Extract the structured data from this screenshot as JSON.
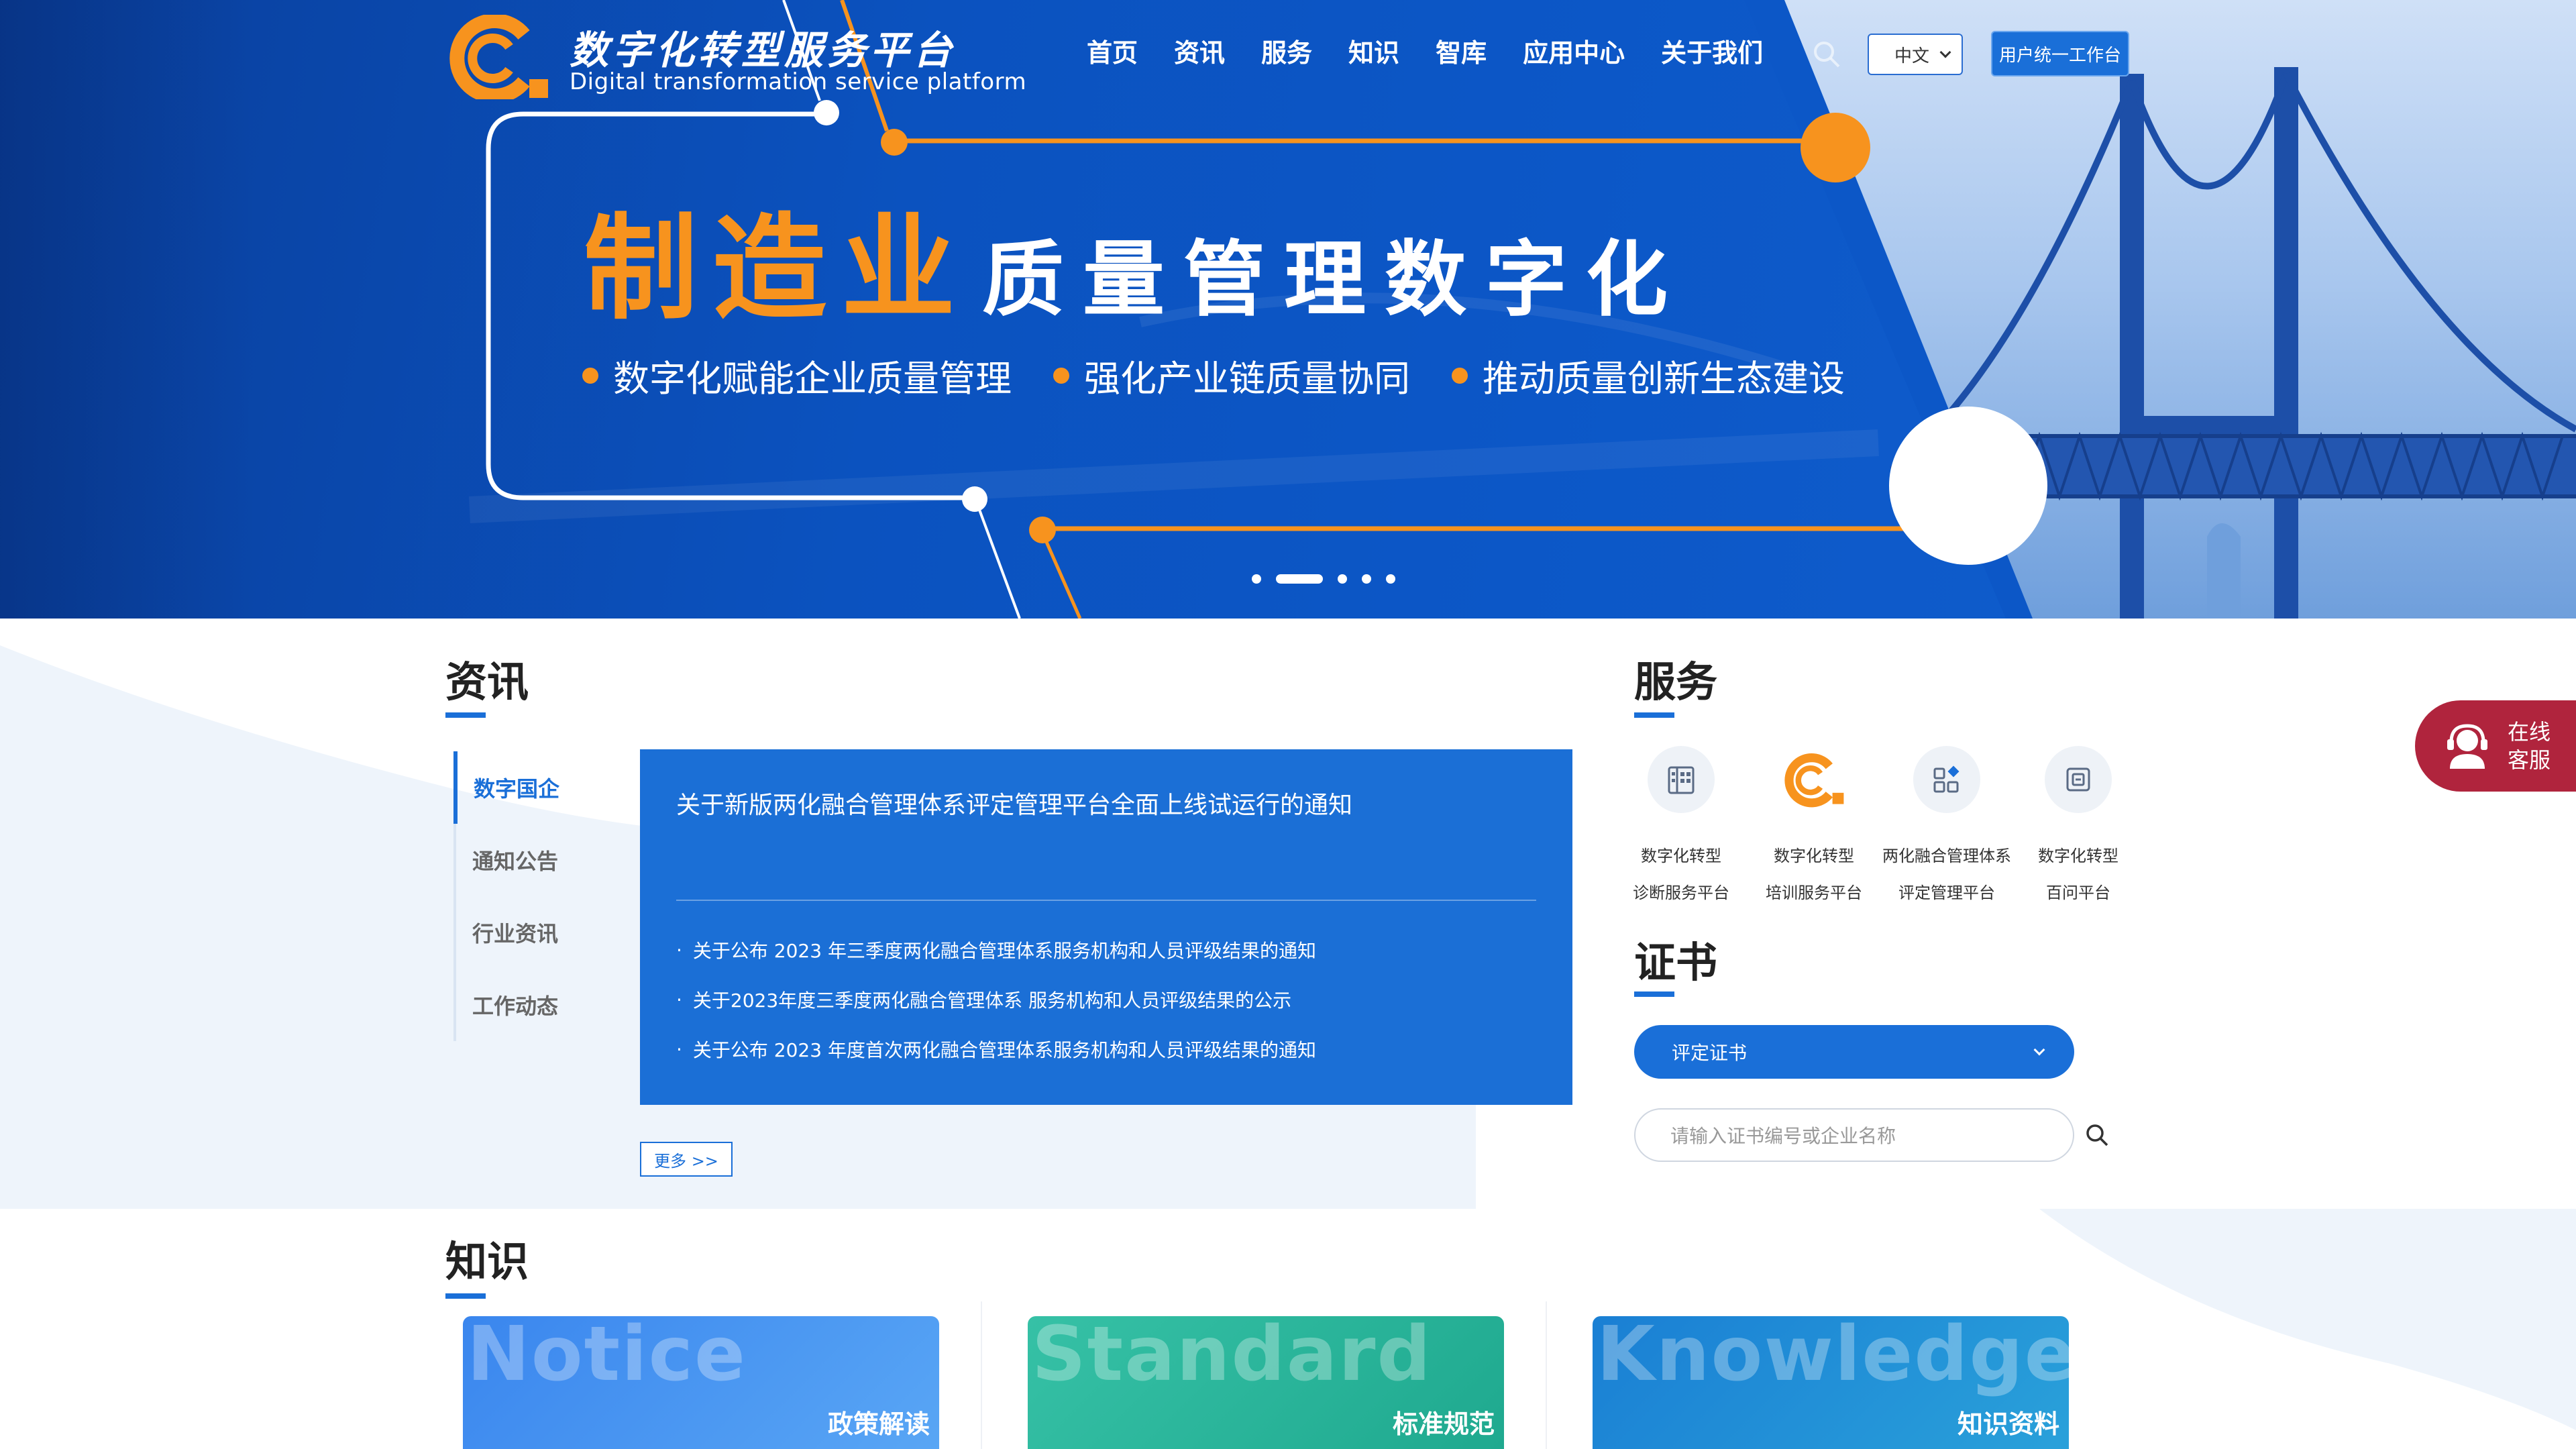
{
  "brand": {
    "name_cn": "数字化转型服务平台",
    "name_en": "Digital transformation service platform",
    "orange": "#f7931e",
    "blue": "#1a6fd8"
  },
  "nav": {
    "items": [
      {
        "label": "首页"
      },
      {
        "label": "资讯"
      },
      {
        "label": "服务"
      },
      {
        "label": "知识"
      },
      {
        "label": "智库"
      },
      {
        "label": "应用中心"
      },
      {
        "label": "关于我们"
      }
    ],
    "search_icon": "search-icon",
    "language": "中文",
    "workbench_label": "用户统一工作台"
  },
  "banner": {
    "title_highlight": "制造业",
    "title_rest": "质量管理数字化",
    "bullets": [
      {
        "text": "数字化赋能企业质量管理"
      },
      {
        "text": "强化产业链质量协同"
      },
      {
        "text": "推动质量创新生态建设"
      }
    ],
    "slide_count": 5,
    "active_slide": 2
  },
  "news": {
    "title": "资讯",
    "tabs": [
      {
        "label": "数字国企",
        "active": true
      },
      {
        "label": "通知公告",
        "active": false
      },
      {
        "label": "行业资讯",
        "active": false
      },
      {
        "label": "工作动态",
        "active": false
      }
    ],
    "headline": "关于新版两化融合管理体系评定管理平台全面上线试运行的通知",
    "items": [
      {
        "text": "关于公布 2023 年三季度两化融合管理体系服务机构和人员评级结果的通知"
      },
      {
        "text": "关于2023年度三季度两化融合管理体系 服务机构和人员评级结果的公示"
      },
      {
        "text": "关于公布 2023 年度首次两化融合管理体系服务机构和人员评级结果的通知"
      }
    ],
    "bullet_sep": "·",
    "more_label": "更多 >>"
  },
  "services": {
    "title": "服务",
    "items": [
      {
        "line1": "数字化转型",
        "line2": "诊断服务平台",
        "icon": "building-icon"
      },
      {
        "line1": "数字化转型",
        "line2": "培训服务平台",
        "icon": "brand-logo-icon"
      },
      {
        "line1": "两化融合管理体系",
        "line2": "评定管理平台",
        "icon": "apps-grid-icon"
      },
      {
        "line1": "数字化转型",
        "line2": "百问平台",
        "icon": "document-icon"
      }
    ]
  },
  "certificate": {
    "title": "证书",
    "select_value": "评定证书",
    "input_placeholder": "请输入证书编号或企业名称"
  },
  "support": {
    "line1": "在线",
    "line2": "客服"
  },
  "knowledge": {
    "title": "知识",
    "cards": [
      {
        "en": "Notice",
        "cn": "政策解读",
        "color_from": "#3a86ee",
        "color_to": "#5aa7f5"
      },
      {
        "en": "Standard",
        "cn": "标准规范",
        "color_from": "#2bb39b",
        "color_to": "#1ea88e"
      },
      {
        "en": "Knowledge",
        "cn": "知识资料",
        "color_from": "#1a7fd4",
        "color_to": "#29a0d8"
      }
    ]
  }
}
